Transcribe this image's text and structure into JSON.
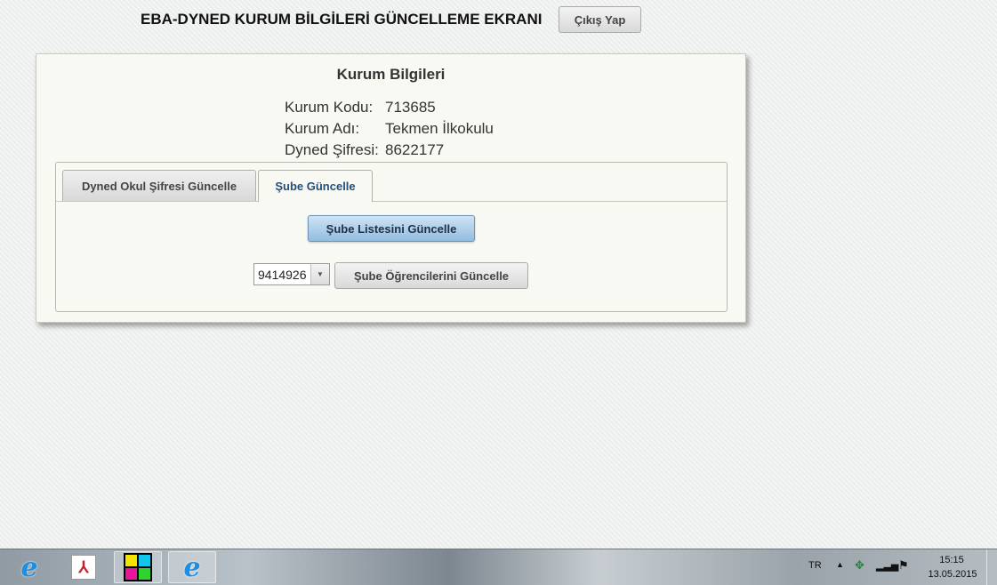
{
  "header": {
    "title": "EBA-DYNED KURUM BİLGİLERİ GÜNCELLEME EKRANI",
    "logout_label": "Çıkış Yap"
  },
  "panel": {
    "title": "Kurum Bilgileri",
    "info": [
      {
        "label": "Kurum Kodu:",
        "value": "713685"
      },
      {
        "label": "Kurum Adı:",
        "value": "Tekmen İlkokulu"
      },
      {
        "label": "Dyned Şifresi:",
        "value": "8622177"
      }
    ]
  },
  "tabs": [
    {
      "label": "Dyned Okul Şifresi Güncelle",
      "active": false
    },
    {
      "label": "Şube Güncelle",
      "active": true
    }
  ],
  "sube_tab": {
    "update_list_label": "Şube Listesini Güncelle",
    "class_select_value": "9414926",
    "update_students_label": "Şube Öğrencilerini Güncelle"
  },
  "taskbar": {
    "apps": [
      {
        "name": "Internet Explorer",
        "icon": "ie-icon"
      },
      {
        "name": "Adobe Reader",
        "icon": "pdf-icon"
      },
      {
        "name": "Color grid app",
        "icon": "grid-icon"
      },
      {
        "name": "Internet Explorer",
        "icon": "ie-icon",
        "active": true
      }
    ],
    "language": "TR",
    "time": "15:15",
    "date": "13.05.2015"
  },
  "colors": {
    "primary_button": "#92bde0",
    "active_tab_text": "#1f4f7a",
    "panel_bg": "#f9f9f3"
  }
}
